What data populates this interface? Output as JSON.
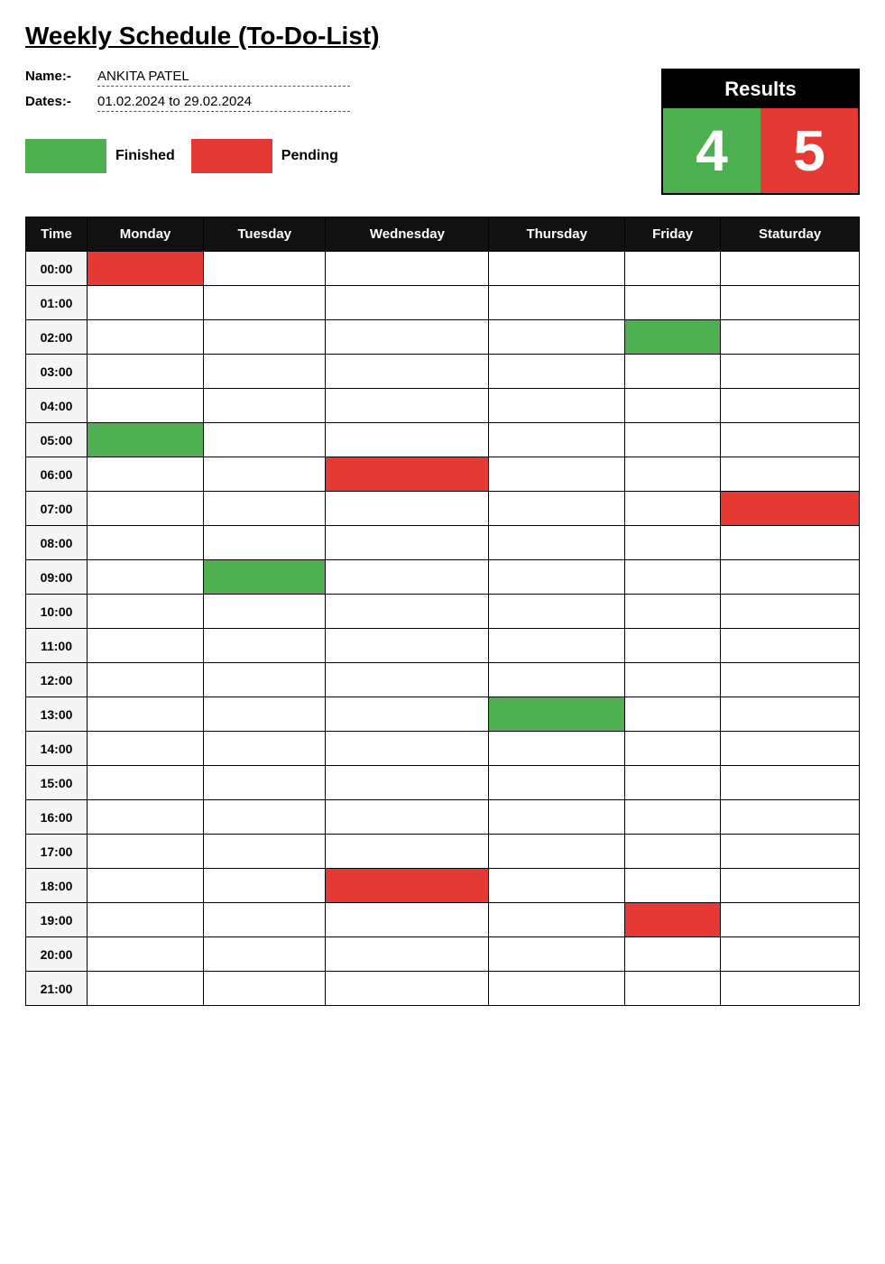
{
  "title": "Weekly Schedule (To-Do-List)",
  "info": {
    "name_label": "Name:-",
    "name_value": "ANKITA PATEL",
    "dates_label": "Dates:-",
    "dates_value": "01.02.2024 to 29.02.2024"
  },
  "legend": {
    "finished_label": "Finished",
    "pending_label": "Pending",
    "finished_color": "#4caf50",
    "pending_color": "#e53935"
  },
  "results": {
    "header": "Results",
    "green_value": "4",
    "red_value": "5"
  },
  "table": {
    "headers": [
      "Time",
      "Monday",
      "Tuesday",
      "Wednesday",
      "Thursday",
      "Friday",
      "Staturday"
    ],
    "rows": [
      {
        "time": "00:00",
        "cells": [
          "red",
          "empty",
          "empty",
          "empty",
          "empty",
          "empty"
        ]
      },
      {
        "time": "01:00",
        "cells": [
          "empty",
          "empty",
          "empty",
          "empty",
          "empty",
          "empty"
        ]
      },
      {
        "time": "02:00",
        "cells": [
          "empty",
          "empty",
          "empty",
          "empty",
          "green",
          "empty"
        ]
      },
      {
        "time": "03:00",
        "cells": [
          "empty",
          "empty",
          "empty",
          "empty",
          "empty",
          "empty"
        ]
      },
      {
        "time": "04:00",
        "cells": [
          "empty",
          "empty",
          "empty",
          "empty",
          "empty",
          "empty"
        ]
      },
      {
        "time": "05:00",
        "cells": [
          "green",
          "empty",
          "empty",
          "empty",
          "empty",
          "empty"
        ]
      },
      {
        "time": "06:00",
        "cells": [
          "empty",
          "empty",
          "red",
          "empty",
          "empty",
          "empty"
        ]
      },
      {
        "time": "07:00",
        "cells": [
          "empty",
          "empty",
          "empty",
          "empty",
          "empty",
          "red"
        ]
      },
      {
        "time": "08:00",
        "cells": [
          "empty",
          "empty",
          "empty",
          "empty",
          "empty",
          "empty"
        ]
      },
      {
        "time": "09:00",
        "cells": [
          "empty",
          "green",
          "empty",
          "empty",
          "empty",
          "empty"
        ]
      },
      {
        "time": "10:00",
        "cells": [
          "empty",
          "empty",
          "empty",
          "empty",
          "empty",
          "empty"
        ]
      },
      {
        "time": "11:00",
        "cells": [
          "empty",
          "empty",
          "empty",
          "empty",
          "empty",
          "empty"
        ]
      },
      {
        "time": "12:00",
        "cells": [
          "empty",
          "empty",
          "empty",
          "empty",
          "empty",
          "empty"
        ]
      },
      {
        "time": "13:00",
        "cells": [
          "empty",
          "empty",
          "empty",
          "green",
          "empty",
          "empty"
        ]
      },
      {
        "time": "14:00",
        "cells": [
          "empty",
          "empty",
          "empty",
          "empty",
          "empty",
          "empty"
        ]
      },
      {
        "time": "15:00",
        "cells": [
          "empty",
          "empty",
          "empty",
          "empty",
          "empty",
          "empty"
        ]
      },
      {
        "time": "16:00",
        "cells": [
          "empty",
          "empty",
          "empty",
          "empty",
          "empty",
          "empty"
        ]
      },
      {
        "time": "17:00",
        "cells": [
          "empty",
          "empty",
          "empty",
          "empty",
          "empty",
          "empty"
        ]
      },
      {
        "time": "18:00",
        "cells": [
          "empty",
          "empty",
          "red",
          "empty",
          "empty",
          "empty"
        ]
      },
      {
        "time": "19:00",
        "cells": [
          "empty",
          "empty",
          "empty",
          "empty",
          "red",
          "empty"
        ]
      },
      {
        "time": "20:00",
        "cells": [
          "empty",
          "empty",
          "empty",
          "empty",
          "empty",
          "empty"
        ]
      },
      {
        "time": "21:00",
        "cells": [
          "empty",
          "empty",
          "empty",
          "empty",
          "empty",
          "empty"
        ]
      }
    ]
  }
}
